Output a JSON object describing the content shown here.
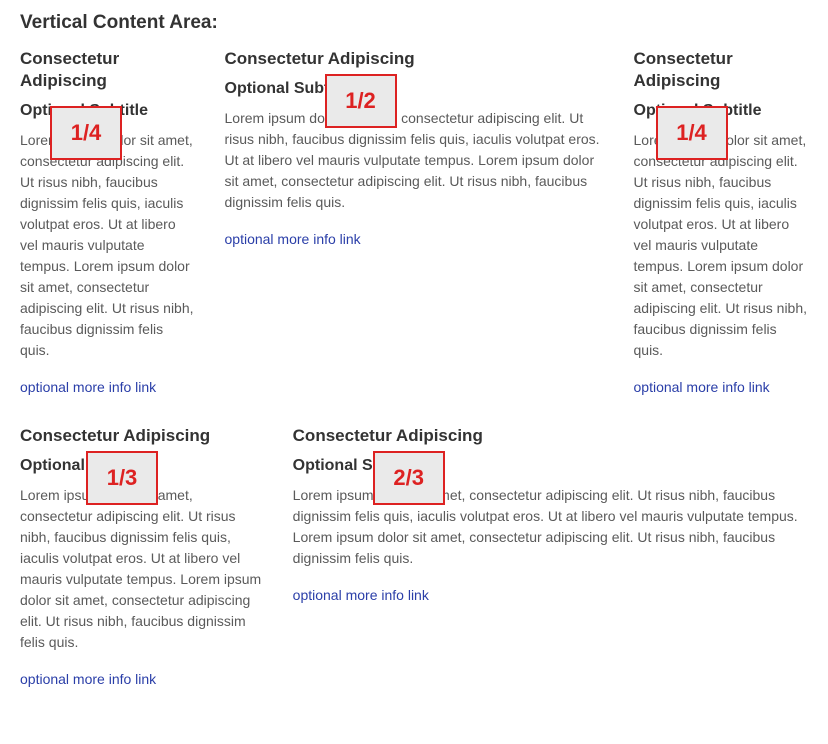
{
  "section": {
    "heading": "Vertical Content Area:"
  },
  "rows": [
    {
      "columns": [
        {
          "badge": "1/4",
          "title": "Consectetur Adipiscing",
          "subtitle": "Optional Subtitle",
          "body": "Lorem ipsum dolor sit amet, consectetur adipiscing elit. Ut risus nibh, faucibus dignissim felis quis, iaculis volutpat eros. Ut at libero vel mauris vulputate tempus. Lorem ipsum dolor sit amet, consectetur adipiscing elit. Ut risus nibh, faucibus dignissim felis quis.",
          "link": "optional more info link"
        },
        {
          "badge": "1/2",
          "title": "Consectetur Adipiscing",
          "subtitle": "Optional Subtitle",
          "body": "Lorem ipsum dolor sit amet, consectetur adipiscing elit. Ut risus nibh, faucibus dignissim felis quis, iaculis volutpat eros. Ut at libero vel mauris vulputate tempus. Lorem ipsum dolor sit amet, consectetur adipiscing elit. Ut risus nibh, faucibus dignissim felis quis.",
          "link": "optional more info link"
        },
        {
          "badge": "1/4",
          "title": "Consectetur Adipiscing",
          "subtitle": "Optional Subtitle",
          "body": "Lorem ipsum dolor sit amet, consectetur adipiscing elit. Ut risus nibh, faucibus dignissim felis quis, iaculis volutpat eros. Ut at libero vel mauris vulputate tempus. Lorem ipsum dolor sit amet, consectetur adipiscing elit. Ut risus nibh, faucibus dignissim felis quis.",
          "link": "optional more info link"
        }
      ]
    },
    {
      "columns": [
        {
          "badge": "1/3",
          "title": "Consectetur Adipiscing",
          "subtitle": "Optional Subtitle",
          "body": "Lorem ipsum dolor sit amet, consectetur adipiscing elit. Ut risus nibh, faucibus dignissim felis quis, iaculis volutpat eros. Ut at libero vel mauris vulputate tempus. Lorem ipsum dolor sit amet, consectetur adipiscing elit. Ut risus nibh, faucibus dignissim felis quis.",
          "link": "optional more info link"
        },
        {
          "badge": "2/3",
          "title": "Consectetur Adipiscing",
          "subtitle": "Optional Subtitle",
          "body": "Lorem ipsum dolor sit amet, consectetur adipiscing elit. Ut risus nibh, faucibus dignissim felis quis, iaculis volutpat eros. Ut at libero vel mauris vulputate tempus. Lorem ipsum dolor sit amet, consectetur adipiscing elit. Ut risus nibh, faucibus dignissim felis quis.",
          "link": "optional more info link"
        }
      ]
    }
  ]
}
